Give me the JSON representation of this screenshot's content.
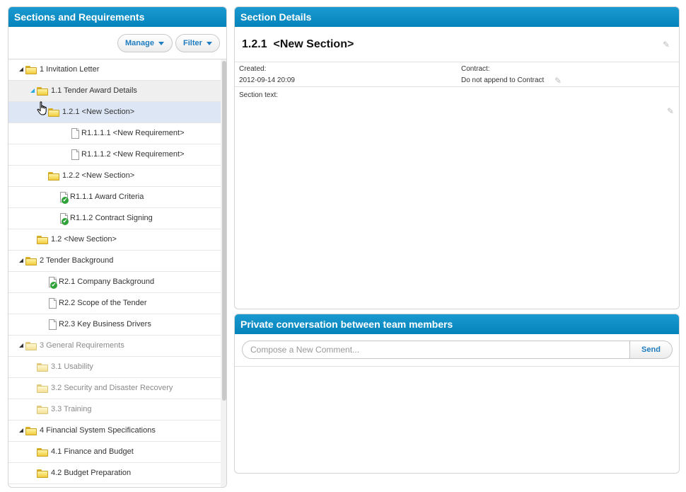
{
  "left_panel": {
    "title": "Sections and Requirements",
    "manage_label": "Manage",
    "filter_label": "Filter"
  },
  "tree": [
    {
      "label": "1 Invitation Letter",
      "kind": "folder",
      "level": 0,
      "expander": "open",
      "state": "normal"
    },
    {
      "label": "1.1 Tender Award Details",
      "kind": "folder",
      "level": 1,
      "expander": "open-blue",
      "state": "hover"
    },
    {
      "label": "1.2.1 <New Section>",
      "kind": "folder",
      "level": 2,
      "expander": "open",
      "state": "selected"
    },
    {
      "label": "R1.1.1.1 <New Requirement>",
      "kind": "doc",
      "level": 3,
      "expander": "none",
      "state": "normal"
    },
    {
      "label": "R1.1.1.2 <New Requirement>",
      "kind": "doc",
      "level": 3,
      "expander": "none",
      "state": "normal"
    },
    {
      "label": "1.2.2 <New Section>",
      "kind": "folder",
      "level": 2,
      "expander": "none",
      "state": "normal"
    },
    {
      "label": "R1.1.1 Award Criteria",
      "kind": "doc-check",
      "level": 2,
      "expander": "none",
      "state": "normal"
    },
    {
      "label": "R1.1.2 Contract Signing",
      "kind": "doc-check",
      "level": 2,
      "expander": "none",
      "state": "normal"
    },
    {
      "label": "1.2 <New Section>",
      "kind": "folder",
      "level": 1,
      "expander": "none",
      "state": "normal"
    },
    {
      "label": "2 Tender Background",
      "kind": "folder",
      "level": 0,
      "expander": "open",
      "state": "normal"
    },
    {
      "label": "R2.1 Company Background",
      "kind": "doc-check",
      "level": 1,
      "expander": "none",
      "state": "normal"
    },
    {
      "label": "R2.2 Scope of the Tender",
      "kind": "doc",
      "level": 1,
      "expander": "none",
      "state": "normal"
    },
    {
      "label": "R2.3 Key Business Drivers",
      "kind": "doc",
      "level": 1,
      "expander": "none",
      "state": "normal"
    },
    {
      "label": "3 General Requirements",
      "kind": "folder",
      "level": 0,
      "expander": "open",
      "state": "dim"
    },
    {
      "label": "3.1 Usability",
      "kind": "folder",
      "level": 1,
      "expander": "none",
      "state": "dim"
    },
    {
      "label": "3.2 Security and Disaster Recovery",
      "kind": "folder",
      "level": 1,
      "expander": "none",
      "state": "dim"
    },
    {
      "label": "3.3 Training",
      "kind": "folder",
      "level": 1,
      "expander": "none",
      "state": "dim"
    },
    {
      "label": "4 Financial System Specifications",
      "kind": "folder",
      "level": 0,
      "expander": "open",
      "state": "normal"
    },
    {
      "label": "4.1 Finance and Budget",
      "kind": "folder",
      "level": 1,
      "expander": "closed",
      "state": "normal"
    },
    {
      "label": "4.2 Budget Preparation",
      "kind": "folder",
      "level": 1,
      "expander": "closed",
      "state": "normal"
    }
  ],
  "details": {
    "title": "Section Details",
    "section_number": "1.2.1",
    "section_name": "<New Section>",
    "created_label": "Created:",
    "created_value": "2012-09-14 20:09",
    "contract_label": "Contract:",
    "contract_value": "Do not append to Contract",
    "section_text_label": "Section text:"
  },
  "conversation": {
    "title": "Private conversation between team members",
    "compose_placeholder": "Compose a New Comment...",
    "send_label": "Send"
  },
  "icons": {
    "edit": "pencil-icon",
    "folder": "folder-icon",
    "document": "document-icon",
    "approved": "check-icon",
    "cursor": "hand-cursor-icon"
  },
  "colors": {
    "header": "#0a8ec3",
    "accent_text": "#1e7cbf",
    "selected_row": "#dde6f4",
    "approved": "#2fa339"
  }
}
